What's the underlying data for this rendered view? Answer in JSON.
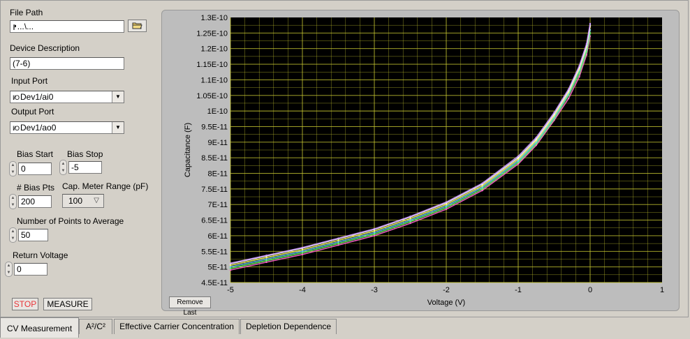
{
  "controls": {
    "file_path": {
      "label": "File Path",
      "value": "...\\..."
    },
    "device_description": {
      "label": "Device Description",
      "value": "(7-6)"
    },
    "input_port": {
      "label": "Input Port",
      "value": "Dev1/ai0"
    },
    "output_port": {
      "label": "Output Port",
      "value": "Dev1/ao0"
    },
    "io_prefix": "I/O",
    "bias_start": {
      "label": "Bias Start",
      "value": "0"
    },
    "bias_stop": {
      "label": "Bias Stop",
      "value": "-5"
    },
    "bias_pts": {
      "label": "# Bias Pts",
      "value": "200"
    },
    "cap_range": {
      "label": "Cap. Meter Range (pF)",
      "value": "100"
    },
    "avg_points": {
      "label": "Number of Points to Average",
      "value": "50"
    },
    "return_voltage": {
      "label": "Return Voltage",
      "value": "0"
    }
  },
  "buttons": {
    "stop": "STOP",
    "measure": "MEASURE",
    "remove_last": "Remove Last"
  },
  "tabs": [
    {
      "label": "CV Measurement",
      "active": true
    },
    {
      "label": "A²/C²",
      "active": false
    },
    {
      "label": "Effective Carrier Concentration",
      "active": false
    },
    {
      "label": "Depletion Dependence",
      "active": false
    }
  ],
  "colors": {
    "plot_background": "#000000",
    "grid": "#c8c832",
    "stop_text": "#e8363a"
  },
  "chart_data": {
    "type": "line",
    "xlabel": "Voltage (V)",
    "ylabel": "Capacitance (F)",
    "xlim": [
      -5,
      1
    ],
    "ylim": [
      4.5e-11,
      1.3e-10
    ],
    "x_ticks": [
      -5,
      -4,
      -3,
      -2,
      -1,
      0,
      1
    ],
    "x_tick_labels": [
      "-5",
      "-4",
      "-3",
      "-2",
      "-1",
      "0",
      "1"
    ],
    "y_ticks": [
      4.5e-11,
      5e-11,
      5.5e-11,
      6e-11,
      6.5e-11,
      7e-11,
      7.5e-11,
      8e-11,
      8.5e-11,
      9e-11,
      9.5e-11,
      1e-10,
      1.05e-10,
      1.1e-10,
      1.15e-10,
      1.2e-10,
      1.25e-10,
      1.3e-10
    ],
    "y_tick_labels": [
      "4.5E-11",
      "5E-11",
      "5.5E-11",
      "6E-11",
      "6.5E-11",
      "7E-11",
      "7.5E-11",
      "8E-11",
      "8.5E-11",
      "9E-11",
      "9.5E-11",
      "1E-10",
      "1.05E-10",
      "1.1E-10",
      "1.15E-10",
      "1.2E-10",
      "1.25E-10",
      "1.3E-10"
    ],
    "grid": true,
    "x": [
      -5,
      -4.5,
      -4,
      -3.5,
      -3,
      -2.5,
      -2,
      -1.5,
      -1,
      -0.75,
      -0.5,
      -0.3,
      -0.15,
      -0.05,
      0
    ],
    "series": [
      {
        "values": [
          4.9e-11,
          5.15e-11,
          5.4e-11,
          5.7e-11,
          6e-11,
          6.4e-11,
          6.85e-11,
          7.45e-11,
          8.3e-11,
          8.9e-11,
          9.7e-11,
          1.04e-10,
          1.11e-10,
          1.18e-10,
          1.24e-10
        ],
        "color": "#ff66cc"
      },
      {
        "values": [
          4.95e-11,
          5.2e-11,
          5.45e-11,
          5.75e-11,
          6.05e-11,
          6.45e-11,
          6.9e-11,
          7.5e-11,
          8.35e-11,
          8.95e-11,
          9.75e-11,
          1.05e-10,
          1.12e-10,
          1.19e-10,
          1.25e-10
        ],
        "color": "#66ff66"
      },
      {
        "values": [
          5e-11,
          5.25e-11,
          5.5e-11,
          5.8e-11,
          6.1e-11,
          6.5e-11,
          6.95e-11,
          7.55e-11,
          8.4e-11,
          9e-11,
          9.8e-11,
          1.055e-10,
          1.13e-10,
          1.2e-10,
          1.26e-10
        ],
        "color": "#66ccff"
      },
      {
        "values": [
          5.05e-11,
          5.3e-11,
          5.55e-11,
          5.85e-11,
          6.15e-11,
          6.55e-11,
          7e-11,
          7.6e-11,
          8.45e-11,
          9.05e-11,
          9.85e-11,
          1.06e-10,
          1.135e-10,
          1.205e-10,
          1.27e-10
        ],
        "color": "#ffff66"
      },
      {
        "values": [
          5.1e-11,
          5.35e-11,
          5.6e-11,
          5.9e-11,
          6.2e-11,
          6.6e-11,
          7.05e-11,
          7.65e-11,
          8.5e-11,
          9.1e-11,
          9.9e-11,
          1.065e-10,
          1.14e-10,
          1.21e-10,
          1.275e-10
        ],
        "color": "#ffffff"
      },
      {
        "values": [
          5.12e-11,
          5.37e-11,
          5.62e-11,
          5.92e-11,
          6.22e-11,
          6.62e-11,
          7.08e-11,
          7.68e-11,
          8.55e-11,
          9.15e-11,
          9.95e-11,
          1.07e-10,
          1.145e-10,
          1.215e-10,
          1.28e-10
        ],
        "color": "#cc99ff"
      }
    ]
  }
}
